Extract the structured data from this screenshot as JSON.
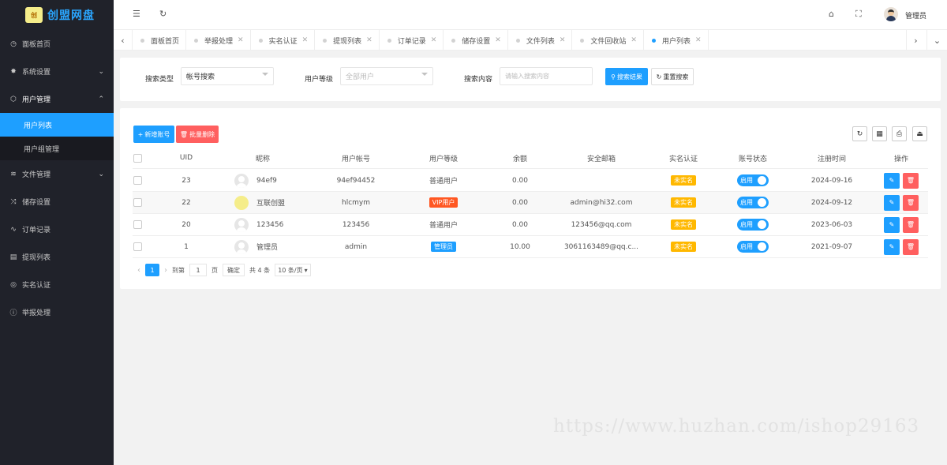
{
  "app": {
    "name": "创盟网盘",
    "logo_text": "创"
  },
  "header": {
    "admin_name": "管理员"
  },
  "sidebar": {
    "items": [
      {
        "label": "面板首页",
        "icon": "dashboard-icon"
      },
      {
        "label": "系统设置",
        "icon": "gear-icon"
      },
      {
        "label": "用户管理",
        "icon": "users-icon"
      },
      {
        "label": "文件管理",
        "icon": "layers-icon"
      },
      {
        "label": "储存设置",
        "icon": "shuffle-icon"
      },
      {
        "label": "订单记录",
        "icon": "pulse-icon"
      },
      {
        "label": "提现列表",
        "icon": "list-icon"
      },
      {
        "label": "实名认证",
        "icon": "check-circle-icon"
      },
      {
        "label": "举报处理",
        "icon": "info-icon"
      }
    ],
    "user_submenu": [
      "用户列表",
      "用户组管理"
    ]
  },
  "tabs": [
    "面板首页",
    "举报处理",
    "实名认证",
    "提现列表",
    "订单记录",
    "储存设置",
    "文件列表",
    "文件回收站",
    "用户列表"
  ],
  "search": {
    "type_label": "搜索类型",
    "type_value": "帐号搜索",
    "level_label": "用户等级",
    "level_placeholder": "全部用户",
    "content_label": "搜索内容",
    "content_placeholder": "请输入搜索内容",
    "search_btn": "搜索结果",
    "reset_btn": "重置搜索"
  },
  "toolbar": {
    "add_btn": "新增账号",
    "delete_btn": "批量删除"
  },
  "table": {
    "headers": [
      "UID",
      "昵称",
      "用户帐号",
      "用户等级",
      "余额",
      "安全邮箱",
      "实名认证",
      "账号状态",
      "注册时间",
      "操作"
    ],
    "rows": [
      {
        "uid": "23",
        "nickname": "94ef9",
        "account": "94ef94452",
        "level": "普通用户",
        "balance": "0.00",
        "email": "",
        "verify": "未实名",
        "status": "启用",
        "date": "2024-09-16"
      },
      {
        "uid": "22",
        "nickname": "互联创盟",
        "account": "hlcmym",
        "level": "VIP用户",
        "balance": "0.00",
        "email": "admin@hi32.com",
        "verify": "未实名",
        "status": "启用",
        "date": "2024-09-12"
      },
      {
        "uid": "20",
        "nickname": "123456",
        "account": "123456",
        "level": "普通用户",
        "balance": "0.00",
        "email": "123456@qq.com",
        "verify": "未实名",
        "status": "启用",
        "date": "2023-06-03"
      },
      {
        "uid": "1",
        "nickname": "管理员",
        "account": "admin",
        "level": "管理员",
        "balance": "10.00",
        "email": "3061163489@qq.c...",
        "verify": "未实名",
        "status": "启用",
        "date": "2021-09-07"
      }
    ]
  },
  "pager": {
    "current": "1",
    "goto_label": "到第",
    "goto_value": "1",
    "page_unit": "页",
    "confirm": "确定",
    "total": "共 4 条",
    "page_size": "10 条/页"
  },
  "watermark": "https://www.huzhan.com/ishop29163",
  "colors": {
    "primary": "#1e9fff",
    "danger": "#ff5f5f",
    "warning": "#ffb800",
    "vip": "#ff5722",
    "sidebar_bg": "#20222a"
  }
}
